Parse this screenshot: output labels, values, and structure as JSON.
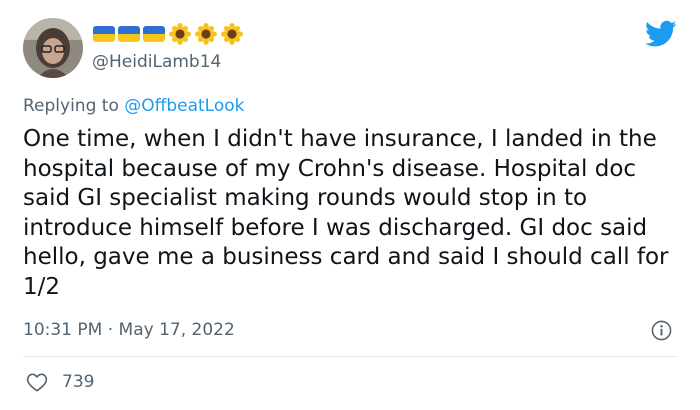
{
  "author": {
    "handle": "@HeidiLamb14",
    "display_name_icons": [
      "ukraine-flag-icon",
      "ukraine-flag-icon",
      "ukraine-flag-icon",
      "sunflower-icon",
      "sunflower-icon",
      "sunflower-icon"
    ]
  },
  "reply": {
    "prefix": "Replying to ",
    "mention": "@OffbeatLook"
  },
  "tweet": {
    "text": "One time, when I didn't have insurance, I landed in the hospital because of my Crohn's disease. Hospital doc said GI specialist making rounds would stop in to introduce himself before I was discharged. GI doc said hello, gave me a business card and said I should call for 1/2",
    "timestamp": "10:31 PM · May 17, 2022"
  },
  "stats": {
    "likes": "739"
  },
  "colors": {
    "twitter_blue": "#1d9bf0",
    "text_secondary": "#536471",
    "flag_blue": "#2f6fd3",
    "flag_yellow": "#f5c518"
  }
}
